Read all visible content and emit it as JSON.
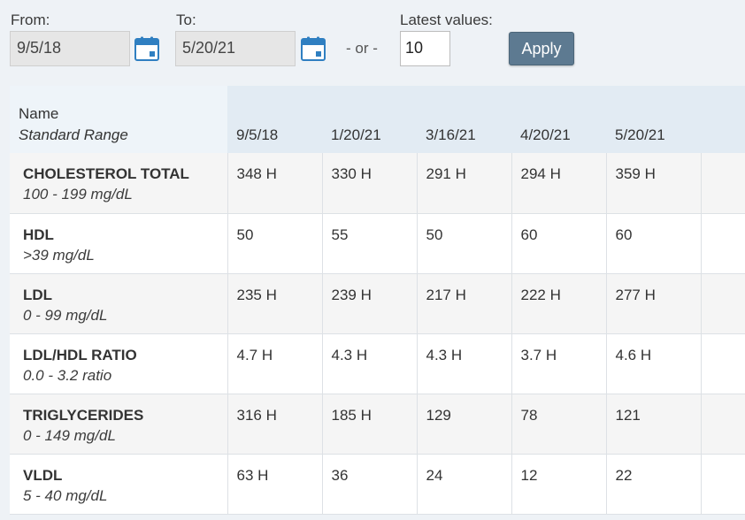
{
  "filters": {
    "from_label": "From:",
    "from_value": "9/5/18",
    "to_label": "To:",
    "to_value": "5/20/21",
    "or_text": "- or -",
    "latest_label": "Latest values:",
    "latest_value": "10",
    "apply_label": "Apply"
  },
  "table": {
    "header": {
      "name": "Name",
      "range": "Standard Range",
      "dates": [
        "9/5/18",
        "1/20/21",
        "3/16/21",
        "4/20/21",
        "5/20/21"
      ]
    },
    "rows": [
      {
        "name": "CHOLESTEROL TOTAL",
        "range": "100 - 199 mg/dL",
        "values": [
          "348 H",
          "330 H",
          "291 H",
          "294 H",
          "359 H"
        ]
      },
      {
        "name": "HDL",
        "range": ">39 mg/dL",
        "values": [
          "50",
          "55",
          "50",
          "60",
          "60"
        ]
      },
      {
        "name": "LDL",
        "range": "0 - 99 mg/dL",
        "values": [
          "235 H",
          "239 H",
          "217 H",
          "222 H",
          "277 H"
        ]
      },
      {
        "name": "LDL/HDL RATIO",
        "range": "0.0 - 3.2 ratio",
        "values": [
          "4.7 H",
          "4.3 H",
          "4.3 H",
          "3.7 H",
          "4.6 H"
        ]
      },
      {
        "name": "TRIGLYCERIDES",
        "range": "0 - 149 mg/dL",
        "values": [
          "316 H",
          "185 H",
          "129",
          "78",
          "121"
        ]
      },
      {
        "name": "VLDL",
        "range": "5 - 40 mg/dL",
        "values": [
          "63 H",
          "36",
          "24",
          "12",
          "22"
        ]
      }
    ]
  },
  "icons": {
    "calendar": "calendar-icon"
  },
  "colors": {
    "apply_button": "#5d7a91",
    "calendar_icon": "#2f7fc1",
    "header_background": "#e2ebf3"
  }
}
